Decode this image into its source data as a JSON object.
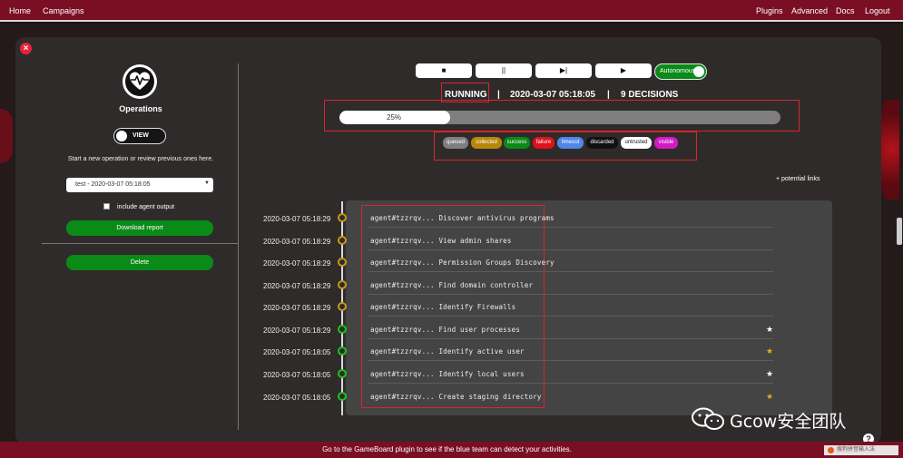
{
  "nav": {
    "left": [
      "Home",
      "Campaigns"
    ],
    "right": [
      "Plugins",
      "Advanced",
      "Docs",
      "Logout"
    ]
  },
  "sidebar": {
    "title": "Operations",
    "view_toggle": "VIEW",
    "start_text": "Start a new operation or review previous ones here.",
    "selected_operation": "test - 2020-03-07 05:18:05",
    "include_agent_output": "include agent output",
    "download_report": "Download report",
    "delete": "Delete"
  },
  "controls": {
    "stop": "■",
    "pause": "||",
    "step": "▶|",
    "play": "▶",
    "autonomous": "Autonomous"
  },
  "status": {
    "state": "RUNNING",
    "separator": "|",
    "started": "2020-03-07 05:18:05",
    "decisions": "9 DECISIONS"
  },
  "progress": {
    "label": "25%",
    "fraction": 0.25
  },
  "legend": [
    {
      "label": "queued",
      "color": "#7f7f7f",
      "text": "#ffffff"
    },
    {
      "label": "collected",
      "color": "#b8860b",
      "text": "#ffffff"
    },
    {
      "label": "success",
      "color": "#0b8a17",
      "text": "#ffffff"
    },
    {
      "label": "failure",
      "color": "#e0111b",
      "text": "#ffffff"
    },
    {
      "label": "timeout",
      "color": "#4f86e8",
      "text": "#ffffff"
    },
    {
      "label": "discarded",
      "color": "#111111",
      "text": "#ffffff"
    },
    {
      "label": "untrusted",
      "color": "#ffffff",
      "text": "#111111"
    },
    {
      "label": "visible",
      "color": "#d21bc4",
      "text": "#ffffff"
    }
  ],
  "potential_links": "+ potential links",
  "timeline": [
    {
      "time": "2020-03-07 05:18:29",
      "text": "agent#tzzrqv... Discover antivirus programs",
      "status": "collected",
      "star": ""
    },
    {
      "time": "2020-03-07 05:18:29",
      "text": "agent#tzzrqv... View admin shares",
      "status": "collected",
      "star": ""
    },
    {
      "time": "2020-03-07 05:18:29",
      "text": "agent#tzzrqv... Permission Groups Discovery",
      "status": "collected",
      "star": ""
    },
    {
      "time": "2020-03-07 05:18:29",
      "text": "agent#tzzrqv... Find domain controller",
      "status": "collected",
      "star": ""
    },
    {
      "time": "2020-03-07 05:18:29",
      "text": "agent#tzzrqv... Identify Firewalls",
      "status": "collected",
      "star": ""
    },
    {
      "time": "2020-03-07 05:18:29",
      "text": "agent#tzzrqv... Find user processes",
      "status": "success",
      "star": "white"
    },
    {
      "time": "2020-03-07 05:18:05",
      "text": "agent#tzzrqv... Identify active user",
      "status": "success",
      "star": "gold"
    },
    {
      "time": "2020-03-07 05:18:05",
      "text": "agent#tzzrqv... Identify local users",
      "status": "success",
      "star": "white"
    },
    {
      "time": "2020-03-07 05:18:05",
      "text": "agent#tzzrqv... Create staging directory",
      "status": "success",
      "star": "gold"
    }
  ],
  "footer": "Go to the GameBoard plugin to see if the blue team can detect your activities.",
  "watermark": "Gcow安全团队",
  "ime_badge": "搜狗拼音输入法",
  "colors": {
    "nav_bg": "#7a0f24",
    "panel_bg": "#2f2b2b",
    "accent_green": "#0a8a17",
    "highlight_red": "#d9262a"
  }
}
